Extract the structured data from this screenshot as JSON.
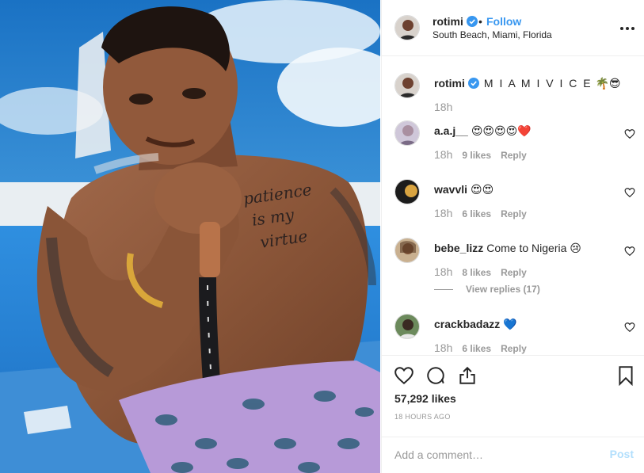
{
  "post": {
    "username": "rotimi",
    "follow_label": "Follow",
    "location": "South Beach, Miami, Florida",
    "verified": true,
    "more_icon": "more-options-icon"
  },
  "comments": [
    {
      "username": "rotimi",
      "text": "M I A M I V I C E",
      "emoji": "🌴😎",
      "time": "18h",
      "verified": true,
      "is_caption": true
    },
    {
      "username": "a.a.j__",
      "text": "",
      "emoji": "😍😍😍😍❤️",
      "time": "18h",
      "likes": "9 likes",
      "reply": "Reply"
    },
    {
      "username": "wavvli",
      "text": "",
      "emoji": "😍😍",
      "time": "18h",
      "likes": "6 likes",
      "reply": "Reply"
    },
    {
      "username": "bebe_lizz",
      "text": "Come to Nigeria",
      "emoji": "😢",
      "time": "18h",
      "likes": "8 likes",
      "reply": "Reply",
      "view_replies": "View replies (17)"
    },
    {
      "username": "crackbadazz",
      "text": "",
      "emoji": "💙",
      "time": "18h",
      "likes": "6 likes",
      "reply": "Reply"
    }
  ],
  "actions": {
    "like_icon": "heart-icon",
    "comment_icon": "comment-icon",
    "share_icon": "share-icon",
    "save_icon": "bookmark-icon"
  },
  "likes_count": "57,292 likes",
  "time_ago": "18 HOURS AGO",
  "add_comment": {
    "placeholder": "Add a comment…",
    "post_label": "Post"
  },
  "colors": {
    "link_blue": "#3897f0",
    "post_disabled": "#b2dffc",
    "muted": "#999999",
    "verified": "#3897f0"
  }
}
